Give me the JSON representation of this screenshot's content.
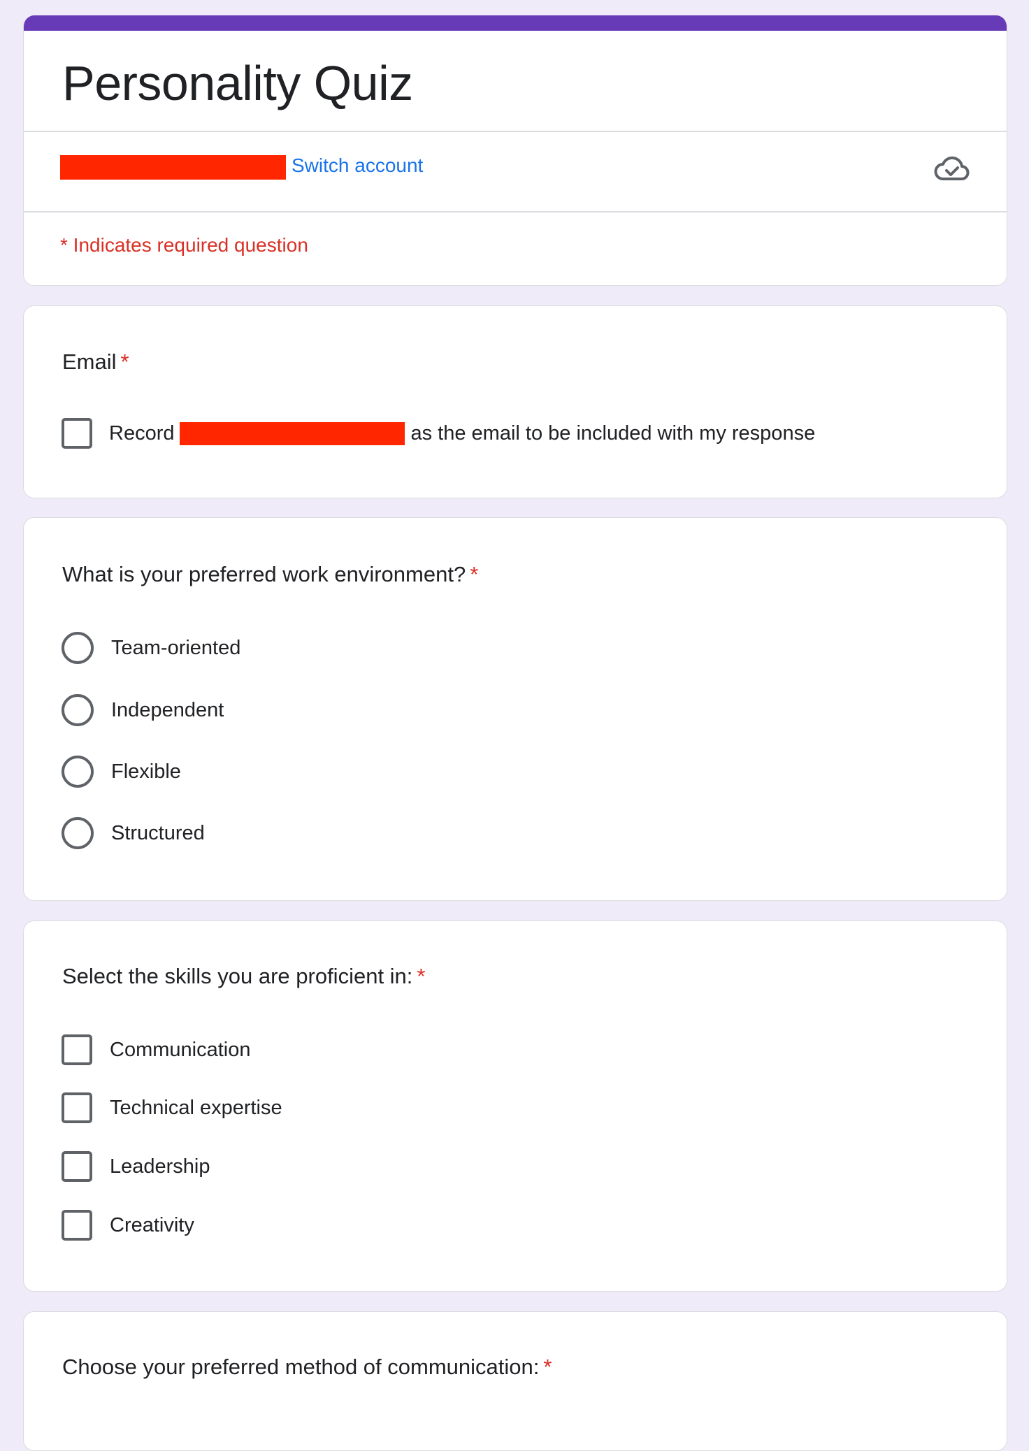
{
  "theme": {
    "accent": "#673ab7",
    "background": "#f0ebf8",
    "link": "#1a73e8",
    "required": "#d93025",
    "redaction": "#ff2600"
  },
  "header": {
    "title": "Personality Quiz",
    "account_redacted": true,
    "switch_account_label": "Switch account",
    "cloud_status_icon": "cloud-done-icon",
    "required_note": "* Indicates required question"
  },
  "questions": [
    {
      "type": "email",
      "title": "Email",
      "required_mark": "*",
      "checkbox_prefix": "Record",
      "email_redacted": true,
      "checkbox_suffix": "as the email to be included with my response",
      "checked": false
    },
    {
      "type": "radio",
      "title": "What is your preferred work environment?",
      "required_mark": "*",
      "options": [
        {
          "label": "Team-oriented",
          "selected": false
        },
        {
          "label": "Independent",
          "selected": false
        },
        {
          "label": "Flexible",
          "selected": false
        },
        {
          "label": "Structured",
          "selected": false
        }
      ]
    },
    {
      "type": "checkbox",
      "title": "Select the skills you are proficient in:",
      "required_mark": "*",
      "options": [
        {
          "label": "Communication",
          "checked": false
        },
        {
          "label": "Technical expertise",
          "checked": false
        },
        {
          "label": "Leadership",
          "checked": false
        },
        {
          "label": "Creativity",
          "checked": false
        }
      ]
    },
    {
      "type": "unknown",
      "title": "Choose your preferred method of communication:",
      "required_mark": "*"
    }
  ]
}
